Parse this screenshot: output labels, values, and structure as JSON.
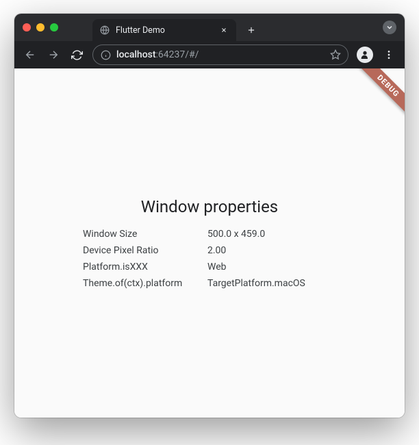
{
  "browser": {
    "tab_title": "Flutter Demo",
    "url_host": "localhost",
    "url_port": ":64237",
    "url_path": "/#/"
  },
  "app": {
    "debug_label": "DEBUG",
    "heading": "Window properties",
    "properties": [
      {
        "label": "Window Size",
        "value": "500.0 x 459.0"
      },
      {
        "label": "Device Pixel Ratio",
        "value": "2.00"
      },
      {
        "label": "Platform.isXXX",
        "value": "Web"
      },
      {
        "label": "Theme.of(ctx).platform",
        "value": "TargetPlatform.macOS"
      }
    ]
  }
}
